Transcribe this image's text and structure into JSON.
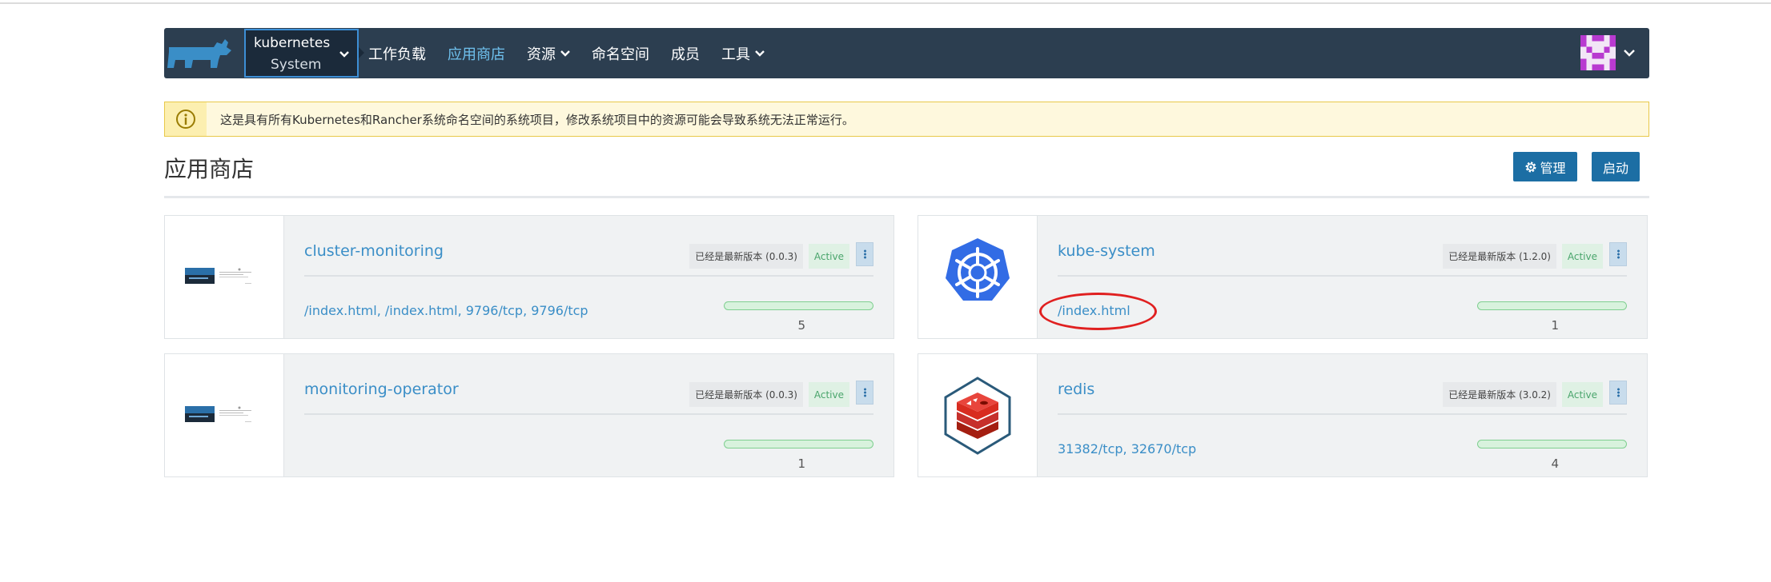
{
  "header": {
    "cluster": {
      "line1": "kubernetes",
      "line2": "System"
    },
    "nav": [
      {
        "label": "工作负载",
        "dropdown": false,
        "active": false
      },
      {
        "label": "应用商店",
        "dropdown": false,
        "active": true
      },
      {
        "label": "资源",
        "dropdown": true,
        "active": false
      },
      {
        "label": "命名空间",
        "dropdown": false,
        "active": false
      },
      {
        "label": "成员",
        "dropdown": false,
        "active": false
      },
      {
        "label": "工具",
        "dropdown": true,
        "active": false
      }
    ]
  },
  "banner": {
    "text": "这是具有所有Kubernetes和Rancher系统命名空间的系统项目，修改系统项目中的资源可能会导致系统无法正常运行。"
  },
  "page": {
    "title": "应用商店",
    "manage_label": "管理",
    "launch_label": "启动"
  },
  "apps": [
    {
      "name": "cluster-monitoring",
      "version": "已经是最新版本 (0.0.3)",
      "status": "Active",
      "endpoints": "/index.html, /index.html, 9796/tcp, 9796/tcp",
      "count": "5",
      "icon": "monitoring-thumbnail"
    },
    {
      "name": "kube-system",
      "version": "已经是最新版本 (1.2.0)",
      "status": "Active",
      "endpoints": "/index.html",
      "count": "1",
      "icon": "kubernetes-helm-icon"
    },
    {
      "name": "monitoring-operator",
      "version": "已经是最新版本 (0.0.3)",
      "status": "Active",
      "endpoints": "",
      "count": "1",
      "icon": "monitoring-thumbnail"
    },
    {
      "name": "redis",
      "version": "已经是最新版本 (3.0.2)",
      "status": "Active",
      "endpoints": "31382/tcp, 32670/tcp",
      "count": "4",
      "icon": "redis-icon"
    }
  ],
  "colors": {
    "header_bg": "#2c3e50",
    "active_nav": "#6fc1ee",
    "primary_button": "#1c6ea4",
    "link": "#3a8ec7",
    "status_active": "#4aa56c",
    "annotation": "#e02020"
  }
}
